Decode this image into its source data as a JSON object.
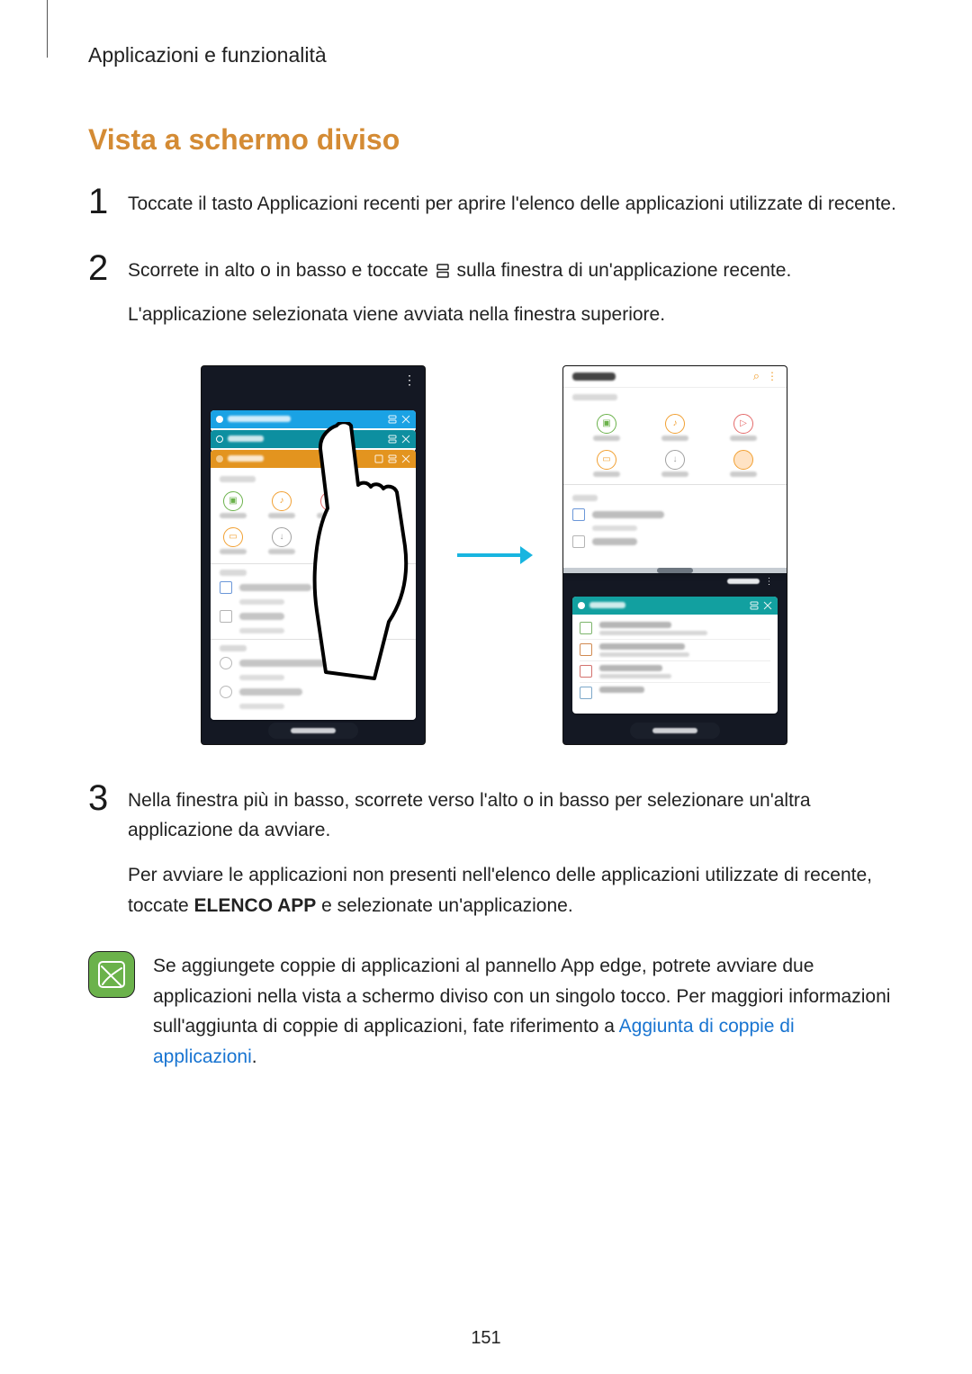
{
  "header": "Applicazioni e funzionalità",
  "heading": "Vista a schermo diviso",
  "steps": {
    "1": {
      "text": "Toccate il tasto Applicazioni recenti per aprire l'elenco delle applicazioni utilizzate di recente."
    },
    "2": {
      "pre": "Scorrete in alto o in basso e toccate ",
      "post": " sulla finestra di un'applicazione recente.",
      "line2": "L'applicazione selezionata viene avviata nella finestra superiore."
    },
    "3": {
      "line1": "Nella finestra più in basso, scorrete verso l'alto o in basso per selezionare un'altra applicazione da avviare.",
      "line2_pre": "Per avviare le applicazioni non presenti nell'elenco delle applicazioni utilizzate di recente, toccate ",
      "line2_bold": "ELENCO APP",
      "line2_post": " e selezionate un'applicazione."
    }
  },
  "note": {
    "text_pre": "Se aggiungete coppie di applicazioni al pannello App edge, potrete avviare due applicazioni nella vista a schermo diviso con un singolo tocco. Per maggiori informazioni sull'aggiunta di coppie di applicazioni, fate riferimento a ",
    "link": "Aggiunta di coppie di applicazioni",
    "text_post": "."
  },
  "page_number": "151"
}
